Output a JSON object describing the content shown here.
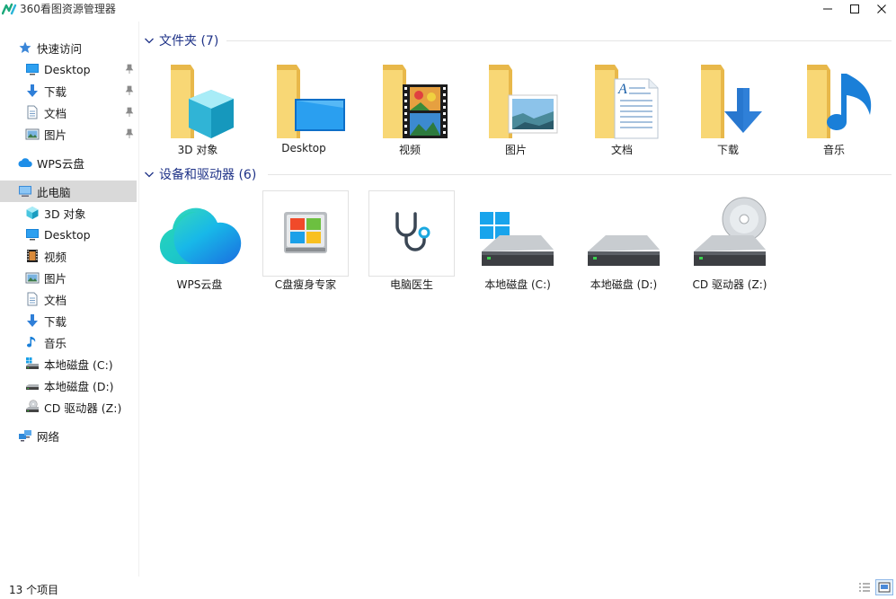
{
  "window": {
    "title": "360看图资源管理器"
  },
  "sidebar": {
    "quick_access": {
      "label": "快速访问",
      "items": [
        {
          "label": "Desktop",
          "icon": "desktop-icon",
          "pinned": true
        },
        {
          "label": "下载",
          "icon": "download-icon",
          "pinned": true
        },
        {
          "label": "文档",
          "icon": "document-icon",
          "pinned": true
        },
        {
          "label": "图片",
          "icon": "picture-icon",
          "pinned": true
        }
      ]
    },
    "wps_cloud": {
      "label": "WPS云盘"
    },
    "this_pc": {
      "label": "此电脑",
      "items": [
        {
          "label": "3D 对象",
          "icon": "cube-icon"
        },
        {
          "label": "Desktop",
          "icon": "desktop-icon"
        },
        {
          "label": "视频",
          "icon": "video-icon"
        },
        {
          "label": "图片",
          "icon": "picture-icon"
        },
        {
          "label": "文档",
          "icon": "document-icon"
        },
        {
          "label": "下载",
          "icon": "download-icon"
        },
        {
          "label": "音乐",
          "icon": "music-icon"
        },
        {
          "label": "本地磁盘 (C:)",
          "icon": "drive-c-icon"
        },
        {
          "label": "本地磁盘 (D:)",
          "icon": "drive-icon"
        },
        {
          "label": "CD 驱动器 (Z:)",
          "icon": "cd-drive-icon"
        }
      ]
    },
    "network": {
      "label": "网络"
    }
  },
  "groups": {
    "folders": {
      "header": "文件夹 (7)",
      "items": [
        {
          "label": "3D 对象",
          "overlay": "cube"
        },
        {
          "label": "Desktop",
          "overlay": "desktop"
        },
        {
          "label": "视频",
          "overlay": "film"
        },
        {
          "label": "图片",
          "overlay": "picture"
        },
        {
          "label": "文档",
          "overlay": "document"
        },
        {
          "label": "下载",
          "overlay": "download"
        },
        {
          "label": "音乐",
          "overlay": "music"
        }
      ]
    },
    "devices": {
      "header": "设备和驱动器 (6)",
      "items": [
        {
          "label": "WPS云盘",
          "icon": "wps-cloud-icon"
        },
        {
          "label": "C盘瘦身专家",
          "icon": "c-drive-cleaner-icon"
        },
        {
          "label": "电脑医生",
          "icon": "stethoscope-icon"
        },
        {
          "label": "本地磁盘 (C:)",
          "icon": "windows-drive-icon"
        },
        {
          "label": "本地磁盘 (D:)",
          "icon": "hard-drive-icon"
        },
        {
          "label": "CD 驱动器 (Z:)",
          "icon": "cd-drive-icon"
        }
      ]
    }
  },
  "status": {
    "item_count": "13 个项目"
  },
  "colors": {
    "accent": "#1e3287",
    "folder": "#f8d775",
    "selection": "#d9d9d9"
  }
}
